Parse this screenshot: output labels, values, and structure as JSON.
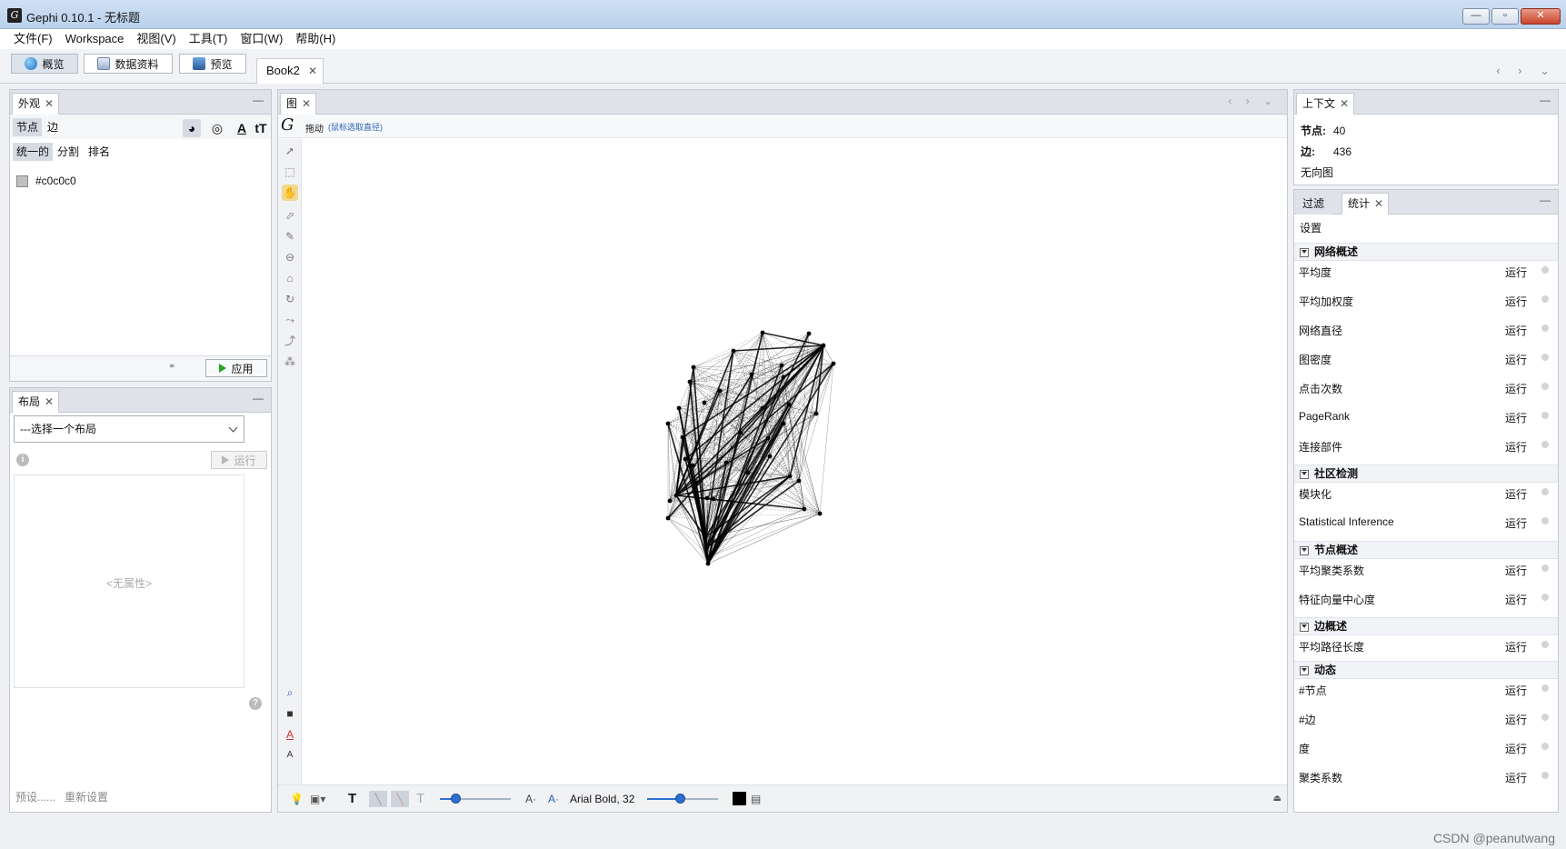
{
  "window": {
    "title": "Gephi 0.10.1 - 无标题",
    "app_icon": "gephi-logo"
  },
  "menu": [
    "文件(F)",
    "Workspace",
    "视图(V)",
    "工具(T)",
    "窗口(W)",
    "帮助(H)"
  ],
  "modes": {
    "overview": "概览",
    "data_lab": "数据资料",
    "preview": "预览"
  },
  "document_tab": "Book2",
  "appearance": {
    "tab": "外观",
    "node_label": "节点",
    "edge_label": "边",
    "unique": "统一的",
    "partition": "分割",
    "ranking": "排名",
    "color_value": "#c0c0c0",
    "apply": "应用"
  },
  "layout": {
    "tab": "布局",
    "select_placeholder": "---选择一个布局",
    "run": "运行",
    "no_properties": "<无属性>",
    "presets": "预设......",
    "reset": "重新设置"
  },
  "graph": {
    "tab": "图",
    "drag_label": "拖动",
    "drag_hint": "(鼠标选取直径)",
    "font_label": "Arial Bold, 32",
    "node_count": 40,
    "edge_count": 436
  },
  "context": {
    "tab": "上下文",
    "nodes_label": "节点:",
    "nodes_value": "40",
    "edges_label": "边:",
    "edges_value": "436",
    "graph_type": "无向图"
  },
  "statistics": {
    "filter_tab": "过滤",
    "stats_tab": "统计",
    "settings": "设置",
    "run_label": "运行",
    "groups": [
      {
        "title": "网络概述",
        "items": [
          "平均度",
          "平均加权度",
          "网络直径",
          "图密度",
          "点击次数",
          "PageRank",
          "连接部件"
        ]
      },
      {
        "title": "社区检测",
        "items": [
          "模块化",
          "Statistical Inference"
        ]
      },
      {
        "title": "节点概述",
        "items": [
          "平均聚类系数",
          "特征向量中心度"
        ]
      },
      {
        "title": "边概述",
        "items": [
          "平均路径长度"
        ]
      },
      {
        "title": "动态",
        "items": [
          "#节点",
          "#边",
          "度",
          "聚类系数"
        ]
      }
    ]
  },
  "watermark": "CSDN @peanutwang",
  "colors": {
    "node": "#000000",
    "edge": "#000000",
    "accent": "#2d6fd1",
    "unique_color": "#c0c0c0"
  }
}
